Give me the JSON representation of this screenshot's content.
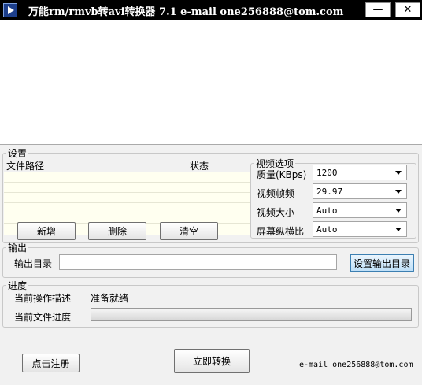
{
  "window": {
    "title": "万能rm/rmvb转avi转换器 7.1  e-mail one256888@tom.com",
    "minimize_label": "—",
    "close_label": "✕"
  },
  "settings": {
    "legend": "设置",
    "columns": [
      "文件路径",
      "状态"
    ],
    "buttons": {
      "add": "新增",
      "delete": "删除",
      "clear": "清空"
    }
  },
  "video_options": {
    "legend": "视频选项",
    "fields": [
      {
        "label": "质量(KBps)",
        "value": "1200"
      },
      {
        "label": "视频帧频",
        "value": "29.97"
      },
      {
        "label": "视频大小",
        "value": "Auto"
      },
      {
        "label": "屏幕纵横比",
        "value": "Auto"
      }
    ]
  },
  "output": {
    "legend": "输出",
    "dir_label": "输出目录",
    "dir_value": "",
    "set_dir_button": "设置输出目录"
  },
  "progress": {
    "legend": "进度",
    "op_label": "当前操作描述",
    "op_value": "准备就绪",
    "file_label": "当前文件进度",
    "file_progress": 0
  },
  "footer": {
    "register_button": "点击注册",
    "convert_button": "立即转换",
    "email": "e-mail one256888@tom.com"
  }
}
